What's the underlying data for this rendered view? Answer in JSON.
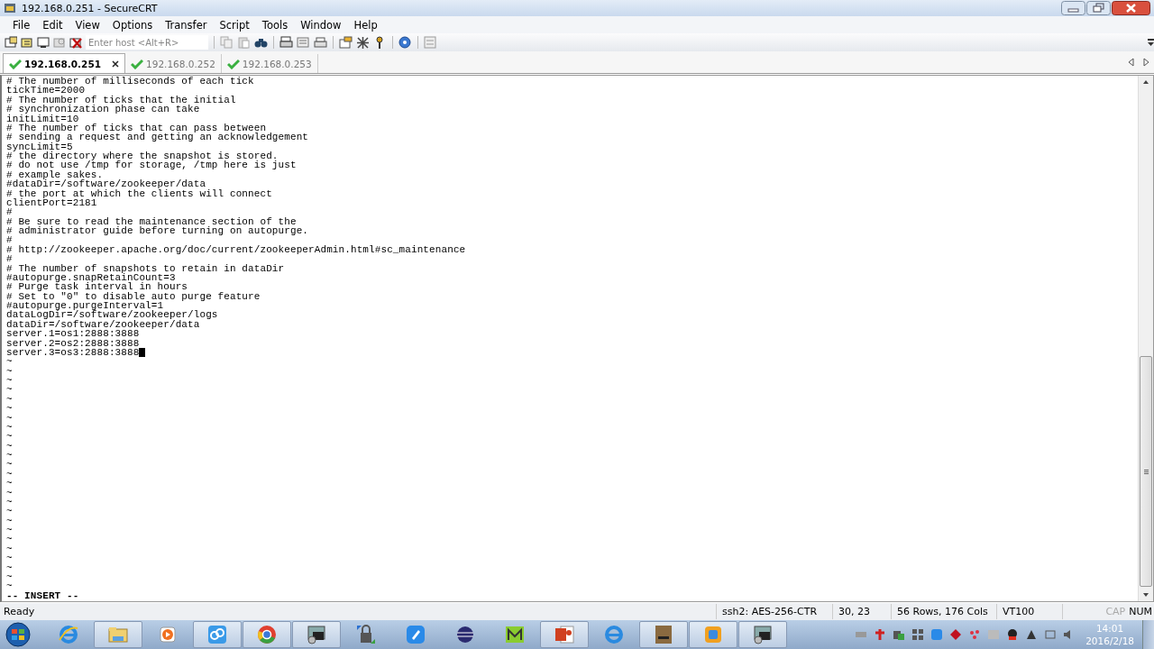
{
  "window": {
    "title": "192.168.0.251 - SecureCRT"
  },
  "menu": [
    "File",
    "Edit",
    "View",
    "Options",
    "Transfer",
    "Script",
    "Tools",
    "Window",
    "Help"
  ],
  "toolbar": {
    "host_field": {
      "placeholder": "Enter host <Alt+R>"
    }
  },
  "tabs": [
    {
      "label": "192.168.0.251",
      "selected": true,
      "connected": true
    },
    {
      "label": "192.168.0.252",
      "selected": false,
      "connected": true
    },
    {
      "label": "192.168.0.253",
      "selected": false,
      "connected": true
    }
  ],
  "terminal": {
    "lines": [
      {
        "text": "# The number of milliseconds of each tick",
        "cursor": false
      },
      {
        "text": "tickTime=2000",
        "cursor": false
      },
      {
        "text": "# The number of ticks that the initial",
        "cursor": false
      },
      {
        "text": "# synchronization phase can take",
        "cursor": false
      },
      {
        "text": "initLimit=10",
        "cursor": false
      },
      {
        "text": "# The number of ticks that can pass between",
        "cursor": false
      },
      {
        "text": "# sending a request and getting an acknowledgement",
        "cursor": false
      },
      {
        "text": "syncLimit=5",
        "cursor": false
      },
      {
        "text": "# the directory where the snapshot is stored.",
        "cursor": false
      },
      {
        "text": "# do not use /tmp for storage, /tmp here is just",
        "cursor": false
      },
      {
        "text": "# example sakes.",
        "cursor": false
      },
      {
        "text": "#dataDir=/software/zookeeper/data",
        "cursor": false
      },
      {
        "text": "# the port at which the clients will connect",
        "cursor": false
      },
      {
        "text": "clientPort=2181",
        "cursor": false
      },
      {
        "text": "#",
        "cursor": false
      },
      {
        "text": "# Be sure to read the maintenance section of the",
        "cursor": false
      },
      {
        "text": "# administrator guide before turning on autopurge.",
        "cursor": false
      },
      {
        "text": "#",
        "cursor": false
      },
      {
        "text": "# http://zookeeper.apache.org/doc/current/zookeeperAdmin.html#sc_maintenance",
        "cursor": false
      },
      {
        "text": "#",
        "cursor": false
      },
      {
        "text": "# The number of snapshots to retain in dataDir",
        "cursor": false
      },
      {
        "text": "#autopurge.snapRetainCount=3",
        "cursor": false
      },
      {
        "text": "# Purge task interval in hours",
        "cursor": false
      },
      {
        "text": "# Set to \"0\" to disable auto purge feature",
        "cursor": false
      },
      {
        "text": "#autopurge.purgeInterval=1",
        "cursor": false
      },
      {
        "text": "dataLogDir=/software/zookeeper/logs",
        "cursor": false
      },
      {
        "text": "dataDir=/software/zookeeper/data",
        "cursor": false
      },
      {
        "text": "server.1=os1:2888:3888",
        "cursor": false
      },
      {
        "text": "server.2=os2:2888:3888",
        "cursor": false
      },
      {
        "text": "server.3=os3:2888:3888",
        "cursor": true
      },
      {
        "text": "~",
        "cursor": false
      },
      {
        "text": "~",
        "cursor": false
      },
      {
        "text": "~",
        "cursor": false
      },
      {
        "text": "~",
        "cursor": false
      },
      {
        "text": "~",
        "cursor": false
      },
      {
        "text": "~",
        "cursor": false
      },
      {
        "text": "~",
        "cursor": false
      },
      {
        "text": "~",
        "cursor": false
      },
      {
        "text": "~",
        "cursor": false
      },
      {
        "text": "~",
        "cursor": false
      },
      {
        "text": "~",
        "cursor": false
      },
      {
        "text": "~",
        "cursor": false
      },
      {
        "text": "~",
        "cursor": false
      },
      {
        "text": "~",
        "cursor": false
      },
      {
        "text": "~",
        "cursor": false
      },
      {
        "text": "~",
        "cursor": false
      },
      {
        "text": "~",
        "cursor": false
      },
      {
        "text": "~",
        "cursor": false
      },
      {
        "text": "~",
        "cursor": false
      },
      {
        "text": "~",
        "cursor": false
      },
      {
        "text": "~",
        "cursor": false
      },
      {
        "text": "~",
        "cursor": false
      },
      {
        "text": "~",
        "cursor": false
      },
      {
        "text": "~",
        "cursor": false
      },
      {
        "text": "~",
        "cursor": false
      }
    ],
    "mode": "-- INSERT --"
  },
  "status_bar": {
    "message": "Ready",
    "cipher": "ssh2: AES-256-CTR",
    "position": "30,  23",
    "size": "56 Rows, 176 Cols",
    "emulation": "VT100",
    "indicators": [
      {
        "label": "CAP",
        "on": false
      },
      {
        "label": "NUM",
        "on": true
      }
    ]
  },
  "taskbar": {
    "clock": {
      "time": "14:01",
      "date": "2016/2/18"
    }
  }
}
